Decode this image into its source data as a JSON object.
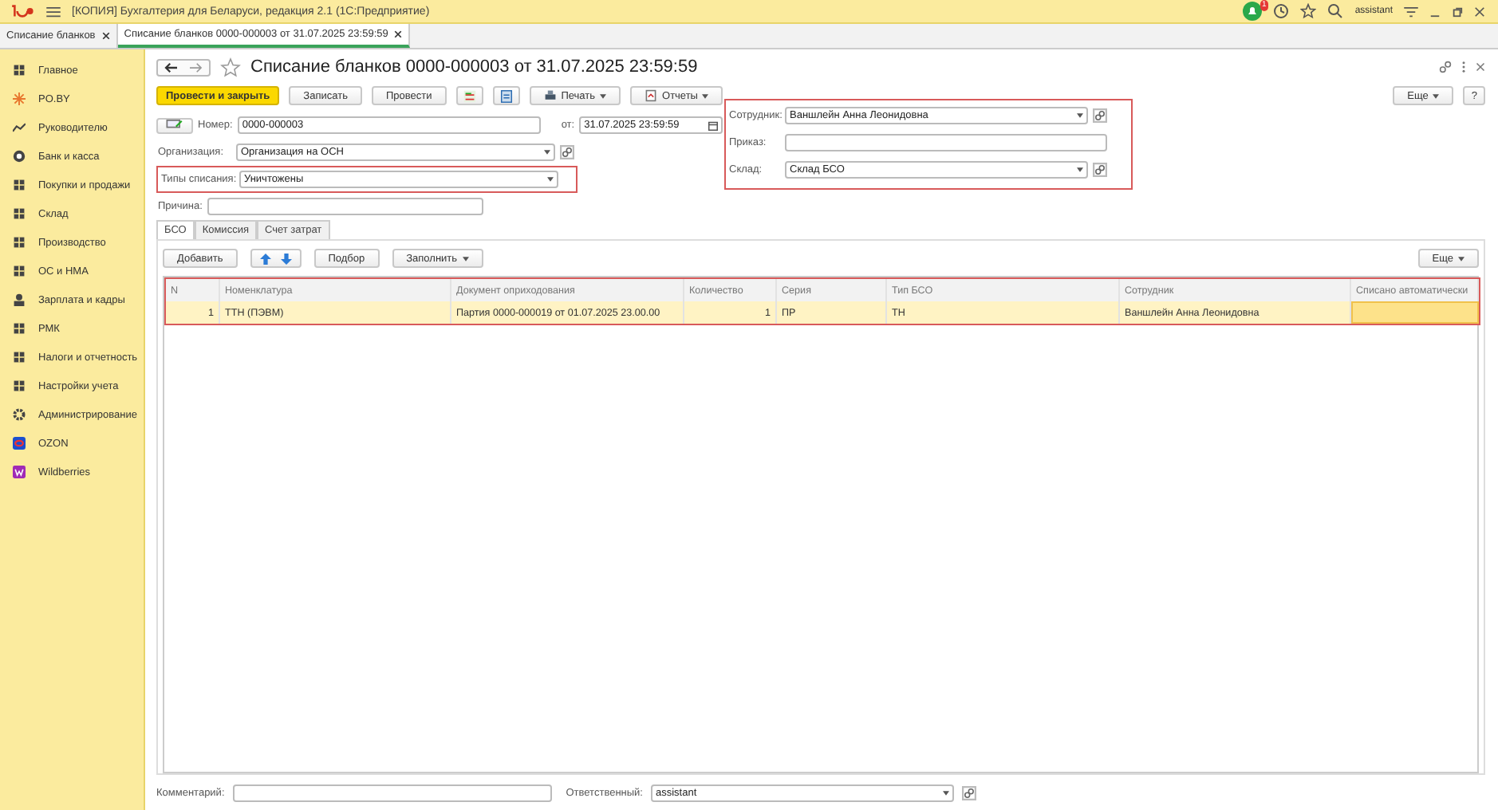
{
  "app_title": "[КОПИЯ] Бухгалтерия для Беларуси, редакция 2.1  (1С:Предприятие)",
  "notification_count": "1",
  "user": "assistant",
  "open_tabs": [
    {
      "label": "Списание бланков",
      "selected": false
    },
    {
      "label": "Списание бланков 0000-000003 от 31.07.2025 23:59:59",
      "selected": true
    }
  ],
  "sidebar": {
    "items": [
      {
        "label": "Главное"
      },
      {
        "label": "PO.BY"
      },
      {
        "label": "Руководителю"
      },
      {
        "label": "Банк и касса"
      },
      {
        "label": "Покупки и продажи"
      },
      {
        "label": "Склад"
      },
      {
        "label": "Производство"
      },
      {
        "label": "ОС и НМА"
      },
      {
        "label": "Зарплата и кадры"
      },
      {
        "label": "РМК"
      },
      {
        "label": "Налоги и отчетность"
      },
      {
        "label": "Настройки учета"
      },
      {
        "label": "Администрирование"
      },
      {
        "label": "OZON"
      },
      {
        "label": "Wildberries"
      }
    ]
  },
  "document": {
    "title": "Списание бланков 0000-000003 от 31.07.2025 23:59:59",
    "toolbar": [
      {
        "kind": "primary",
        "label": "Провести и закрыть"
      },
      {
        "kind": "plain",
        "label": "Записать"
      },
      {
        "kind": "plain",
        "label": "Провести"
      },
      {
        "kind": "icon"
      },
      {
        "kind": "icon"
      },
      {
        "kind": "menu",
        "label": "Печать"
      },
      {
        "kind": "menu",
        "label": "Отчеты"
      }
    ],
    "more_button": "Еще",
    "help_button": "?",
    "number": {
      "label": "Номер:",
      "value": "0000-000003"
    },
    "date": {
      "label": "от:",
      "value": "31.07.2025 23:59:59"
    },
    "organization": {
      "label": "Организация:",
      "value": "Организация на ОСН"
    },
    "writeoff_type": {
      "label": "Типы списания:",
      "value": "Уничтожены",
      "highlighted": true
    },
    "reason": {
      "label": "Причина:"
    },
    "right_block": {
      "highlighted": true,
      "fields": [
        {
          "label": "Сотрудник:",
          "value": "Ваншлейн Анна Леонидовна",
          "kind": "select"
        },
        {
          "label": "Приказ:",
          "kind": "text"
        },
        {
          "label": "Склад:",
          "value": "Склад БСО",
          "kind": "select"
        }
      ]
    },
    "tabs": [
      {
        "label": "БСО",
        "selected": true
      },
      {
        "label": "Комиссия",
        "selected": false
      },
      {
        "label": "Счет затрат",
        "selected": false
      }
    ],
    "table_toolbar": {
      "add": "Добавить",
      "pick": "Подбор",
      "fill": "Заполнить",
      "more": "Еще"
    },
    "table": {
      "highlighted": true,
      "columns": [
        "N",
        "Номенклатура",
        "Документ оприходования",
        "Количество",
        "Серия",
        "Тип БСО",
        "Сотрудник",
        "Списано автоматически"
      ],
      "rows": [
        {
          "selected": true,
          "cells": [
            "1",
            "ТТН (ПЭВМ)",
            "Партия 0000-000019 от 01.07.2025 23.00.00",
            "1",
            "ПР",
            "ТН",
            "Ваншлейн Анна Леонидовна",
            ""
          ]
        }
      ]
    },
    "comment": {
      "label": "Комментарий:"
    },
    "responsible": {
      "label": "Ответственный:",
      "value": "assistant"
    }
  }
}
